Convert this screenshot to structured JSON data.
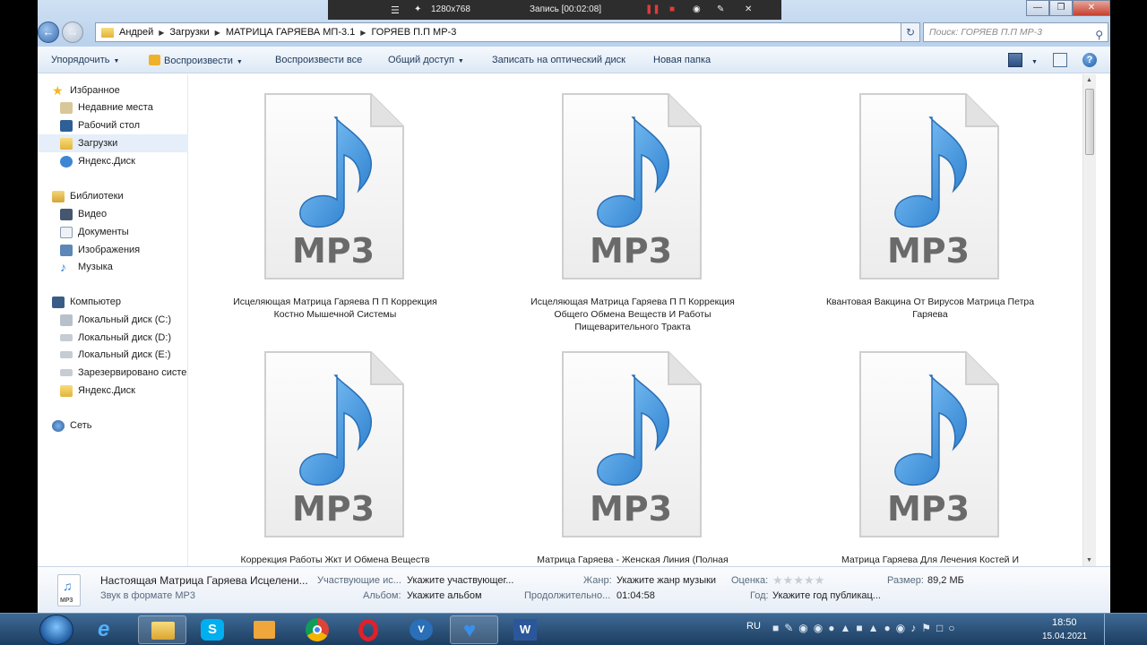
{
  "recorder": {
    "resolution": "1280x768",
    "status": "Запись [00:02:08]"
  },
  "address": {
    "crumbs": [
      "Андрей",
      "Загрузки",
      "МАТРИЦА ГАРЯЕВА МП-3.1",
      "ГОРЯЕВ П.П МР-3"
    ]
  },
  "search": {
    "placeholder": "Поиск: ГОРЯЕВ П.П МР-3"
  },
  "toolbar": {
    "organize": "Упорядочить",
    "play": "Воспроизвести",
    "play_all": "Воспроизвести все",
    "share": "Общий доступ",
    "burn": "Записать на оптический диск",
    "new_folder": "Новая папка"
  },
  "sidebar": {
    "favorites": "Избранное",
    "recent": "Недавние места",
    "desktop": "Рабочий стол",
    "downloads": "Загрузки",
    "yadisk": "Яндекс.Диск",
    "libraries": "Библиотеки",
    "video": "Видео",
    "documents": "Документы",
    "images": "Изображения",
    "music": "Музыка",
    "computer": "Компьютер",
    "disk_c": "Локальный диск (C:)",
    "disk_d": "Локальный диск (D:)",
    "disk_e": "Локальный диск (E:)",
    "reserved": "Зарезервировано систе",
    "yadisk2": "Яндекс.Диск",
    "network": "Сеть"
  },
  "files": [
    {
      "line1": "Исцеляющая Матрица Гаряева П П Коррекция",
      "line2": "Костно Мышечной Системы",
      "line3": ""
    },
    {
      "line1": "Исцеляющая Матрица Гаряева П П Коррекция",
      "line2": "Общего Обмена Веществ И Работы",
      "line3": "Пищеварительного Тракта"
    },
    {
      "line1": "Квантовая Вакцина От Вирусов Матрица Петра",
      "line2": "Гаряева",
      "line3": ""
    },
    {
      "line1": "Коррекция Работы Жкт И Обмена Веществ",
      "line2": "",
      "line3": ""
    },
    {
      "line1": "Матрица Гаряева - Женская Линия (Полная",
      "line2": "",
      "line3": ""
    },
    {
      "line1": "Матрица Гаряева Для Лечения Костей И",
      "line2": "",
      "line3": ""
    }
  ],
  "icon_text": "MP3",
  "details": {
    "name": "Настоящая Матрица Гаряева Исцелени...",
    "type": "Звук в формате MP3",
    "participants_label": "Участвующие ис...",
    "participants_value": "Укажите участвующег...",
    "album_label": "Альбом:",
    "album_value": "Укажите альбом",
    "genre_label": "Жанр:",
    "genre_value": "Укажите жанр музыки",
    "duration_label": "Продолжительно...",
    "duration_value": "01:04:58",
    "rating_label": "Оценка:",
    "year_label": "Год:",
    "year_value": "Укажите год публикац...",
    "size_label": "Размер:",
    "size_value": "89,2 МБ"
  },
  "taskbar": {
    "lang": "RU",
    "time": "18:50",
    "date": "15.04.2021"
  },
  "colors": {
    "note_blue": "#3a8fd6",
    "accent": "#1e395b"
  }
}
